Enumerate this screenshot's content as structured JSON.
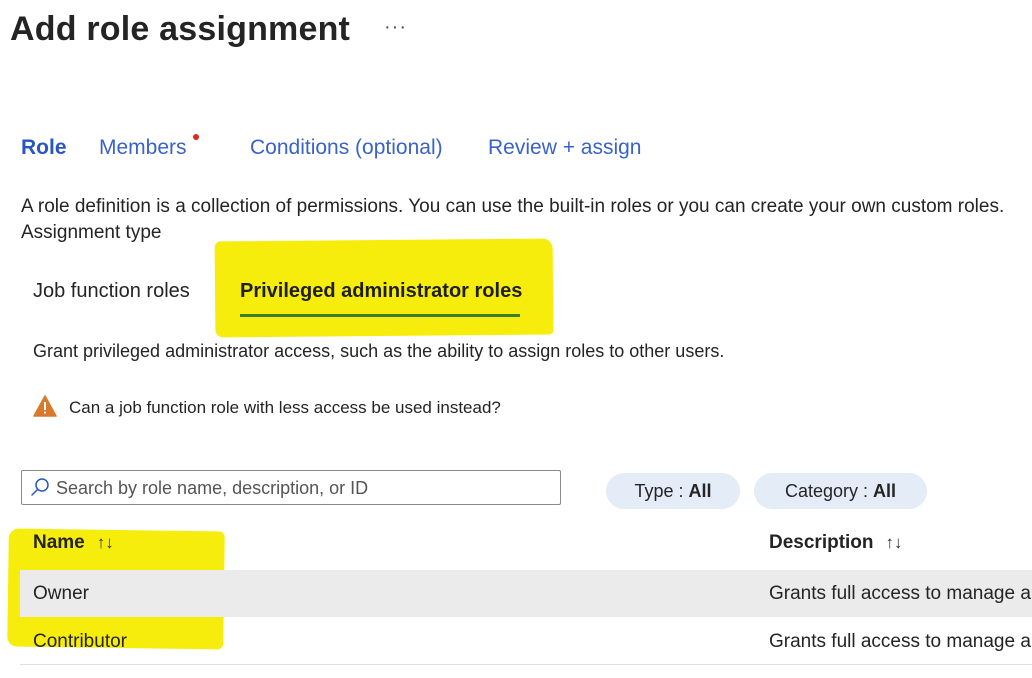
{
  "header": {
    "title": "Add role assignment",
    "more_label": "···"
  },
  "tabs": [
    {
      "label": "Role",
      "active": true
    },
    {
      "label": "Members",
      "has_indicator": true
    },
    {
      "label": "Conditions (optional)"
    },
    {
      "label": "Review + assign"
    }
  ],
  "description": "A role definition is a collection of permissions. You can use the built-in roles or you can create your own custom roles.",
  "assignment_type_label": "Assignment type",
  "subtabs": [
    {
      "label": "Job function roles"
    },
    {
      "label": "Privileged administrator roles",
      "active": true
    }
  ],
  "grant_text": "Grant privileged administrator access, such as the ability to assign roles to other users.",
  "warning": {
    "icon": "warning-icon",
    "text": "Can a job function role with less access be used instead?"
  },
  "search": {
    "placeholder": "Search by role name, description, or ID",
    "value": ""
  },
  "filters": {
    "type": {
      "label": "Type :",
      "value": "All"
    },
    "category": {
      "label": "Category :",
      "value": "All"
    }
  },
  "table": {
    "columns": [
      {
        "label": "Name",
        "sort": "↑↓"
      },
      {
        "label": "Description",
        "sort": "↑↓"
      }
    ],
    "rows": [
      {
        "name": "Owner",
        "description": "Grants full access to manage all resources"
      },
      {
        "name": "Contributor",
        "description": "Grants full access to manage all resources"
      }
    ]
  },
  "colors": {
    "tab_link": "#3a63c8",
    "highlight": "#f5ec00",
    "subtab_underline": "#3b7d2b",
    "pill_bg": "#e4ecf7",
    "selected_row": "#ebebeb",
    "warning": "#d9792b"
  }
}
